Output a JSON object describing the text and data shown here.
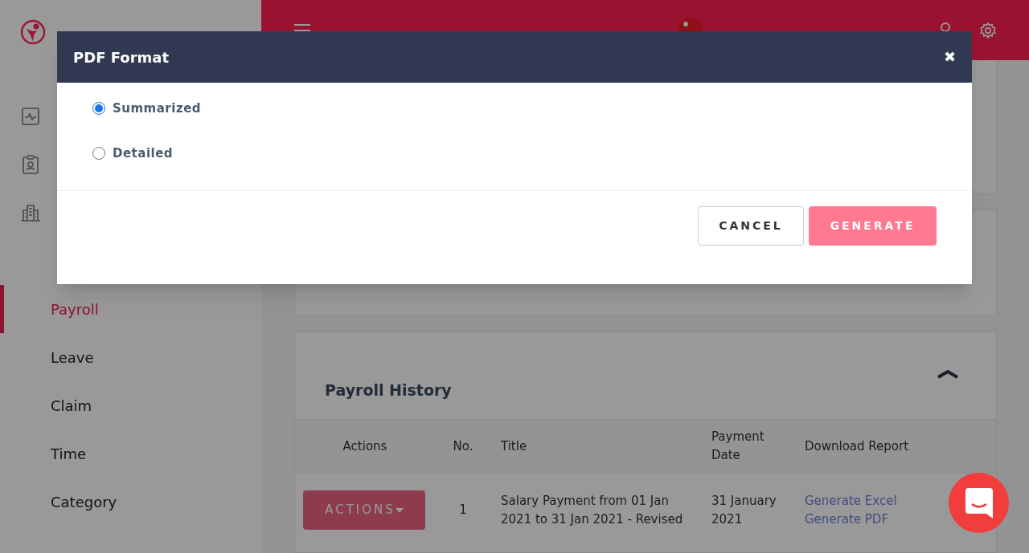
{
  "sidebar": {
    "items": [
      {
        "label": "Payroll",
        "selected": true
      },
      {
        "label": "Leave",
        "selected": false
      },
      {
        "label": "Claim",
        "selected": false
      },
      {
        "label": "Time",
        "selected": false
      },
      {
        "label": "Category",
        "selected": false
      }
    ]
  },
  "payroll_history": {
    "title": "Payroll History",
    "table": {
      "columns": [
        "Actions",
        "No.",
        "Title",
        "Payment Date",
        "Download Report"
      ],
      "rows": [
        {
          "action": "ACTIONS",
          "no": "1",
          "title": "Salary Payment from 01 Jan 2021 to 31 Jan 2021 - Revised",
          "payment_date": "31 January 2021",
          "links": [
            "Generate Excel",
            "Generate PDF"
          ]
        }
      ]
    }
  },
  "modal": {
    "title": "PDF Format",
    "close": "✖",
    "options": [
      {
        "label": "Summarized",
        "selected": true
      },
      {
        "label": "Detailed",
        "selected": false
      }
    ],
    "buttons": [
      {
        "label": "CANCEL",
        "kind": "secondary"
      },
      {
        "label": "GENERATE",
        "kind": "primary"
      }
    ]
  }
}
